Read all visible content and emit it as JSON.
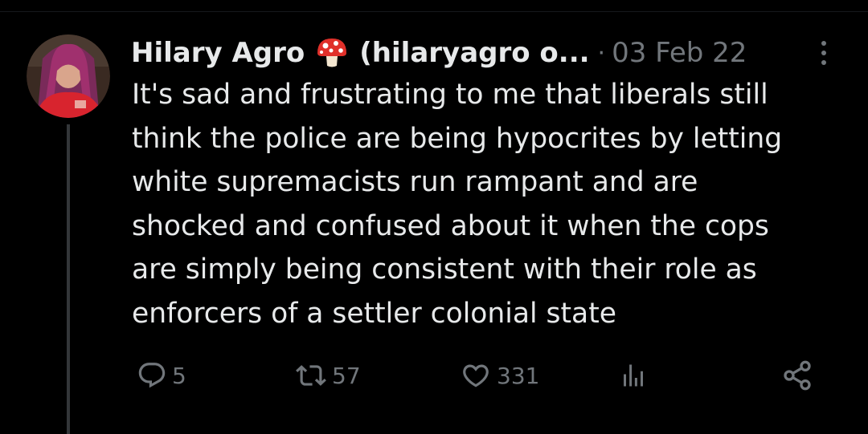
{
  "tweet": {
    "author": {
      "display_name": "Hilary Agro",
      "emoji_icon": "mushroom-icon",
      "handle_truncated": "(hilaryagro o..."
    },
    "separator": "·",
    "date": "03 Feb 22",
    "text": "It's sad and frustrating to me that liberals still\nthink the police are being hypocrites by letting\nwhite supremacists run rampant and are\nshocked and confused about it when the cops\nare simply being consistent with their role as\nenforcers of a settler colonial state",
    "actions": {
      "replies": {
        "icon": "reply-icon",
        "count": "5"
      },
      "reposts": {
        "icon": "repost-icon",
        "count": "57"
      },
      "likes": {
        "icon": "heart-icon",
        "count": "331"
      },
      "views": {
        "icon": "views-icon"
      },
      "share": {
        "icon": "share-icon"
      }
    }
  },
  "colors": {
    "background": "#000000",
    "primary_text": "#e7e9ea",
    "secondary_text": "#71767b",
    "thread_line": "#333639"
  }
}
